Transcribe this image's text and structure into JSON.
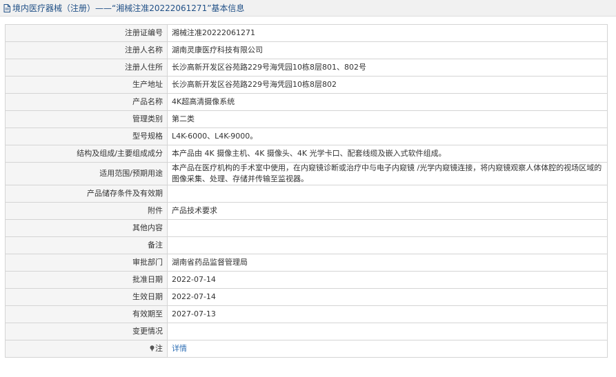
{
  "header": {
    "icon": "document-icon",
    "title": "境内医疗器械（注册）——“湘械注准20222061271”基本信息"
  },
  "rows": [
    {
      "label": "注册证编号",
      "value": "湘械注准20222061271"
    },
    {
      "label": "注册人名称",
      "value": "湖南灵康医疗科技有限公司"
    },
    {
      "label": "注册人住所",
      "value": "长沙高新开发区谷苑路229号海凭园10栋8层801、802号"
    },
    {
      "label": "生产地址",
      "value": "长沙高新开发区谷苑路229号海凭园10栋8层802"
    },
    {
      "label": "产品名称",
      "value": "4K超高清摄像系统"
    },
    {
      "label": "管理类别",
      "value": "第二类"
    },
    {
      "label": "型号规格",
      "value": "L4K-6000、L4K-9000。"
    },
    {
      "label": "结构及组成/主要组成成分",
      "value": "本产品由 4K 摄像主机、4K 摄像头、4K 光学卡口、配套线缆及嵌入式软件组成。"
    },
    {
      "label": "适用范围/预期用途",
      "value": "本产品在医疗机构的手术室中使用，在内窥镜诊断或治疗中与电子内窥镜 /光学内窥镜连接，将内窥镜观察人体体腔的视场区域的图像采集、处理、存储并传输至监视器。"
    },
    {
      "label": "产品储存条件及有效期",
      "value": ""
    },
    {
      "label": "附件",
      "value": "产品技术要求"
    },
    {
      "label": "其他内容",
      "value": ""
    },
    {
      "label": "备注",
      "value": ""
    },
    {
      "label": "审批部门",
      "value": "湖南省药品监督管理局"
    },
    {
      "label": "批准日期",
      "value": "2022-07-14"
    },
    {
      "label": "生效日期",
      "value": "2022-07-14"
    },
    {
      "label": "有效期至",
      "value": "2027-07-13"
    },
    {
      "label": "变更情况",
      "value": ""
    }
  ],
  "note": {
    "icon": "pin-icon",
    "label": "注",
    "link_text": "详情"
  },
  "colors": {
    "title_text": "#1f4f86",
    "link": "#2f6fb5",
    "label_bg": "#f5f5f5",
    "border": "#d4d4d4"
  }
}
